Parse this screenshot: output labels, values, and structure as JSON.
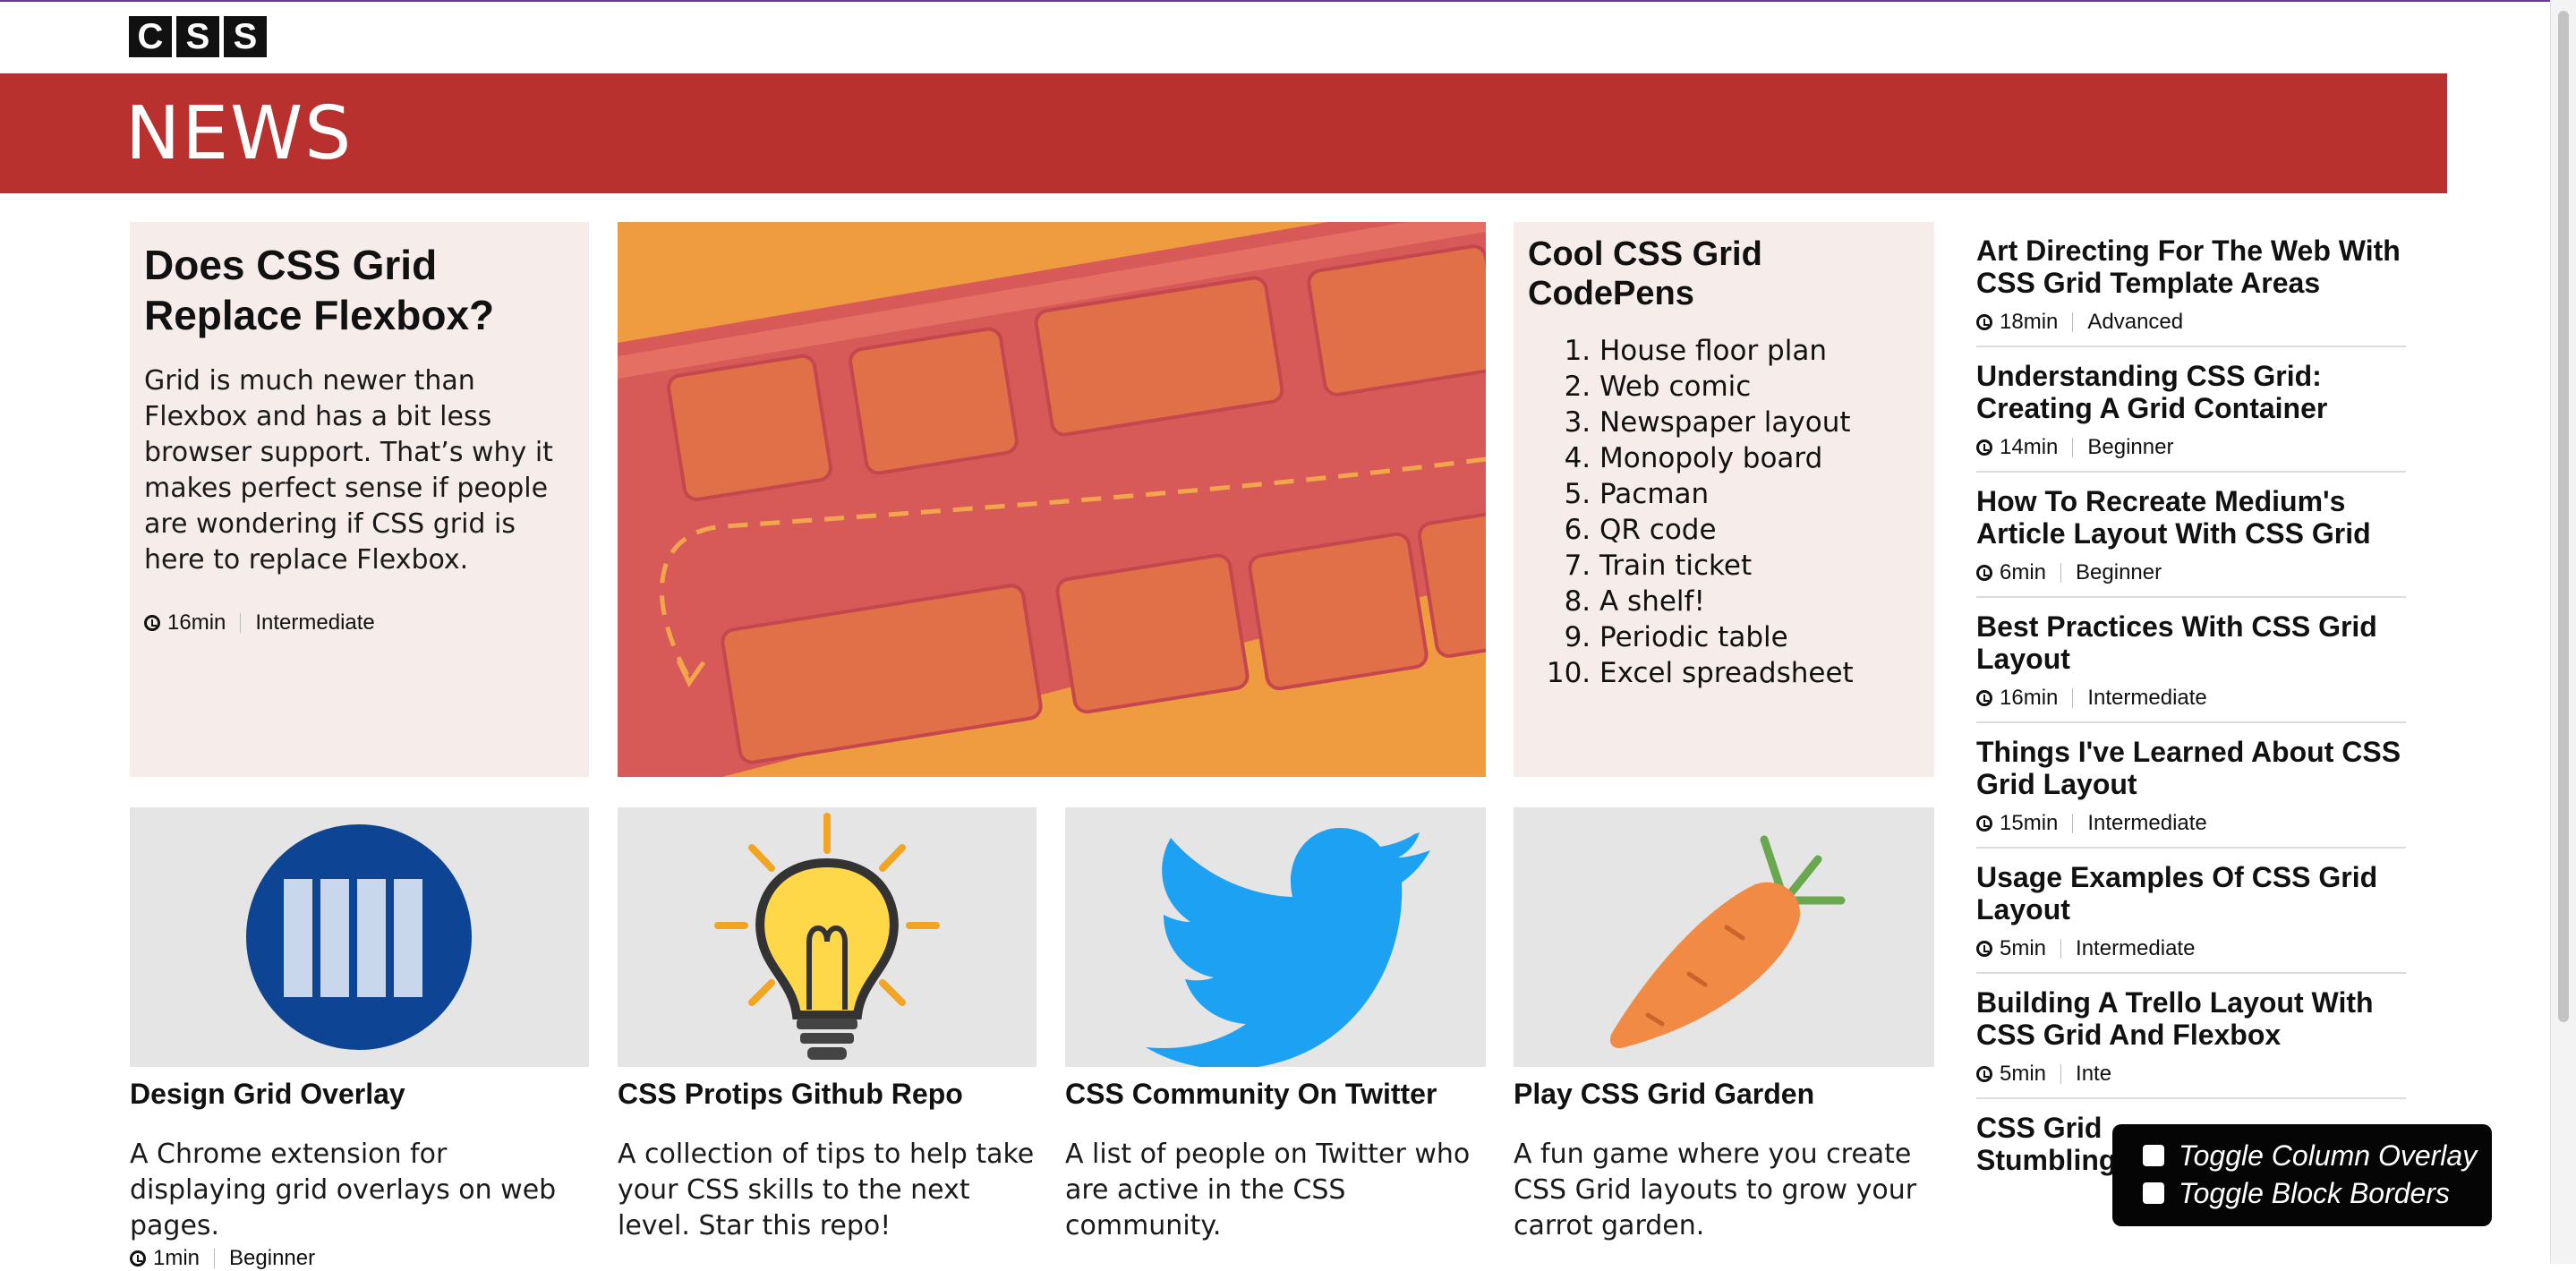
{
  "logo": {
    "letters": [
      "C",
      "S",
      "S"
    ]
  },
  "banner": {
    "title": "NEWS"
  },
  "feature": {
    "title": "Does CSS Grid Replace Flexbox?",
    "body": "Grid is much newer than Flexbox and has a bit less browser support. That’s why it makes perfect sense if people are wondering if CSS grid is here to replace Flexbox.",
    "time": "16min",
    "level": "Intermediate"
  },
  "codepens": {
    "title": "Cool CSS Grid CodePens",
    "items": [
      "House floor plan",
      "Web comic",
      "Newspaper layout",
      "Monopoly board",
      "Pacman",
      "QR code",
      "Train ticket",
      "A shelf!",
      "Periodic table",
      "Excel spreadsheet"
    ]
  },
  "sidebar": {
    "items": [
      {
        "title": "Art Directing For The Web With CSS Grid Template Areas",
        "time": "18min",
        "level": "Advanced"
      },
      {
        "title": "Understanding CSS Grid: Creating A Grid Container",
        "time": "14min",
        "level": "Beginner"
      },
      {
        "title": "How To Recreate Medium's Article Layout With CSS Grid",
        "time": "6min",
        "level": "Beginner"
      },
      {
        "title": "Best Practices With CSS Grid Layout",
        "time": "16min",
        "level": "Intermediate"
      },
      {
        "title": "Things I've Learned About CSS Grid Layout",
        "time": "15min",
        "level": "Intermediate"
      },
      {
        "title": "Usage Examples Of CSS Grid Layout",
        "time": "5min",
        "level": "Intermediate"
      },
      {
        "title": "Building A Trello Layout With CSS Grid And Flexbox",
        "time": "5min",
        "level": "Inte"
      },
      {
        "title": "CSS Grid",
        "title_line2": "Stumbling Blocks"
      }
    ]
  },
  "tiles": [
    {
      "title": "Design Grid Overlay",
      "desc": "A Chrome extension for displaying grid overlays on web pages.",
      "time": "1min",
      "level": "Beginner",
      "icon": "grid-overlay-icon"
    },
    {
      "title": "CSS Protips Github Repo",
      "desc": "A collection of tips to help take your CSS skills to the next level. Star this repo!",
      "icon": "lightbulb-icon"
    },
    {
      "title": "CSS Community On Twitter",
      "desc": "A list of people on Twitter who are active in the CSS community.",
      "icon": "twitter-bird-icon"
    },
    {
      "title": "Play CSS Grid Garden",
      "desc": "A fun game where you create CSS Grid layouts to grow your carrot garden.",
      "icon": "carrot-icon"
    }
  ],
  "overlay": {
    "toggle_columns": "Toggle Column Overlay",
    "toggle_borders": "Toggle Block Borders"
  },
  "colors": {
    "banner": "#b8312f",
    "card_bg": "#f6ecea",
    "hero_bg": "#ef9b3f",
    "twitter": "#1da1f2"
  }
}
